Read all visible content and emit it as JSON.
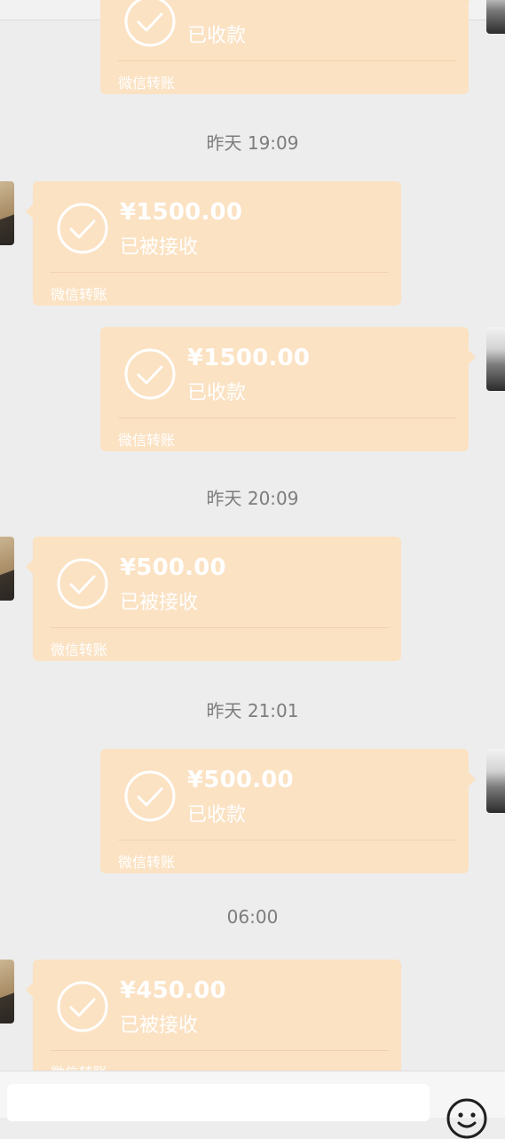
{
  "timestamps": [
    "昨天 19:09",
    "昨天 20:09",
    "昨天 21:01",
    "06:00"
  ],
  "transfers": [
    {
      "amount": "",
      "status": "已收款",
      "footer": "微信转账"
    },
    {
      "amount": "¥1500.00",
      "status": "已被接收",
      "footer": "微信转账"
    },
    {
      "amount": "¥1500.00",
      "status": "已收款",
      "footer": "微信转账"
    },
    {
      "amount": "¥500.00",
      "status": "已被接收",
      "footer": "微信转账"
    },
    {
      "amount": "¥500.00",
      "status": "已收款",
      "footer": "微信转账"
    },
    {
      "amount": "¥450.00",
      "status": "已被接收",
      "footer": "微信转账"
    }
  ],
  "colors": {
    "bubble": "#fbe2c3",
    "background": "#ededed",
    "timestamp": "#7d7d7d"
  },
  "icons": [
    "check-circle-icon",
    "emoji-icon"
  ]
}
